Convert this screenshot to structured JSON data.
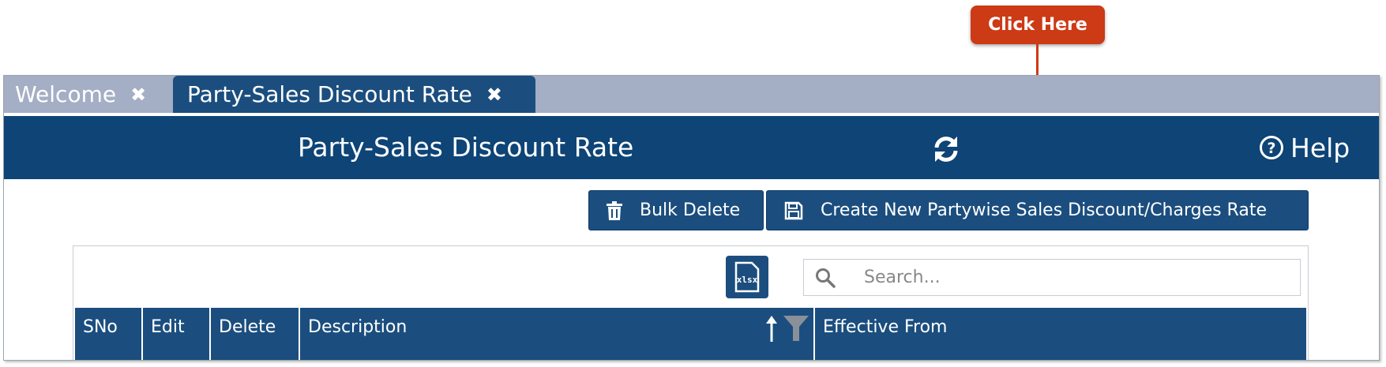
{
  "callout": {
    "label": "Click Here"
  },
  "tabs": [
    {
      "label": "Welcome",
      "active": false
    },
    {
      "label": "Party-Sales Discount Rate",
      "active": true
    }
  ],
  "header": {
    "title": "Party-Sales Discount Rate",
    "help_label": "Help"
  },
  "toolbar": {
    "bulk_delete_label": "Bulk Delete",
    "create_label": "Create New Partywise Sales Discount/Charges Rate"
  },
  "grid": {
    "export_icon": "xlsx-export-icon",
    "search": {
      "placeholder": "Search...",
      "value": ""
    },
    "columns": [
      "SNo",
      "Edit",
      "Delete",
      "Description",
      "Effective From"
    ]
  },
  "colors": {
    "primary": "#1b4e7e",
    "title_bar": "#0e4476",
    "tab_strip": "#a4aec4",
    "callout": "#cc3a16"
  }
}
